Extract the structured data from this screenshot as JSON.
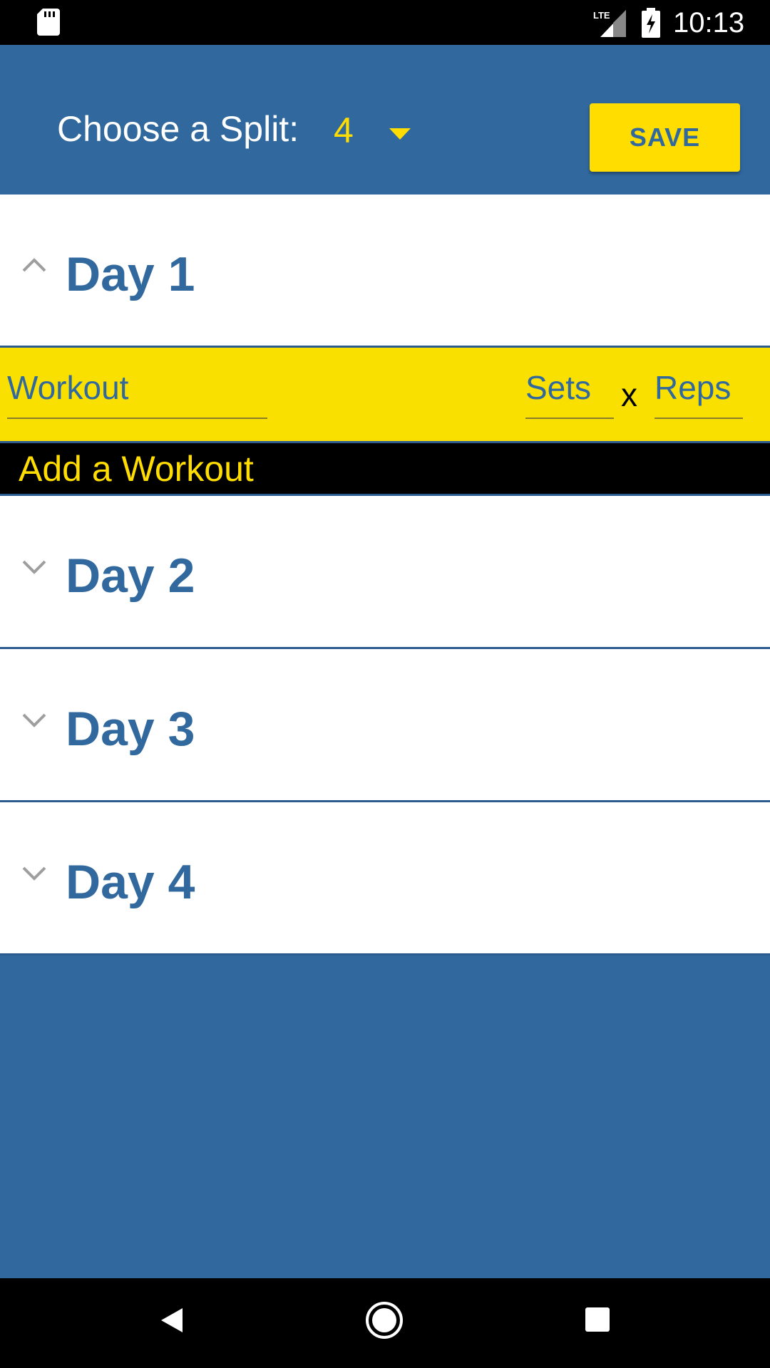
{
  "status_bar": {
    "time": "10:13",
    "network": "LTE",
    "icons": [
      "sd-card-icon",
      "lte-signal-icon",
      "battery-charging-icon"
    ]
  },
  "header": {
    "split_label": "Choose a Split:",
    "split_value": "4",
    "save_label": "SAVE"
  },
  "days": [
    {
      "title": "Day 1",
      "expanded": true
    },
    {
      "title": "Day 2",
      "expanded": false
    },
    {
      "title": "Day 3",
      "expanded": false
    },
    {
      "title": "Day 4",
      "expanded": false
    }
  ],
  "workout_row": {
    "workout_placeholder": "Workout",
    "sets_placeholder": "Sets",
    "times_sign": "x",
    "reps_placeholder": "Reps"
  },
  "add_workout_label": "Add a Workout",
  "colors": {
    "primary_blue": "#31699F",
    "accent_yellow": "#FFDD00",
    "row_yellow": "#FAE000",
    "divider": "#2B5B8F"
  },
  "nav_bar": {
    "icons": [
      "back-icon",
      "home-icon",
      "recents-icon"
    ]
  }
}
